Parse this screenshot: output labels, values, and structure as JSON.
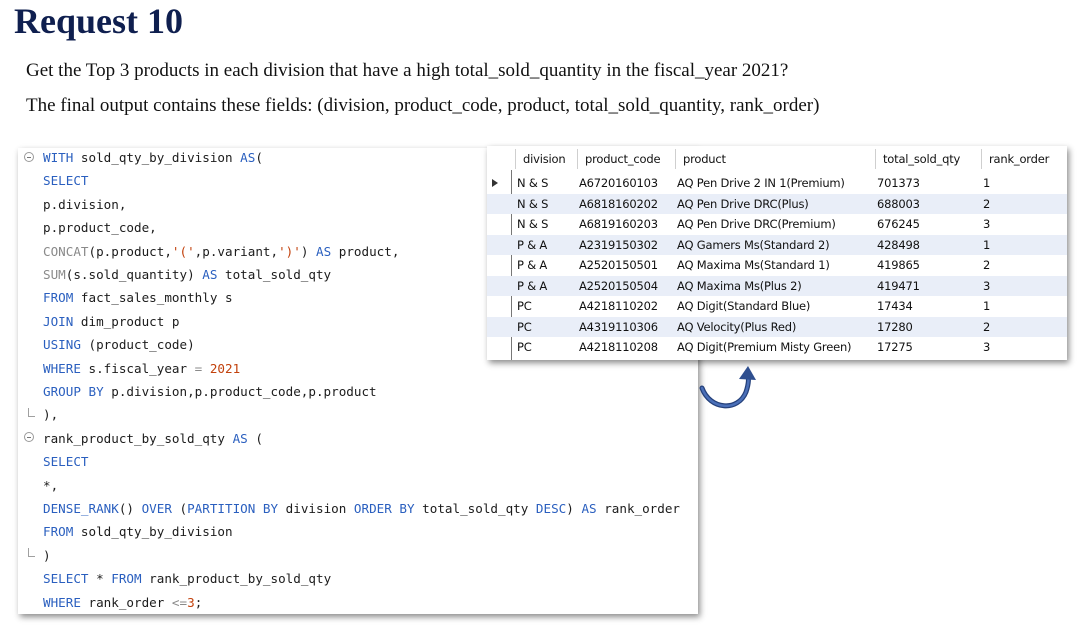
{
  "header": {
    "title": "Request 10",
    "description_line1": "Get the Top 3 products in each division that have a high total_sold_quantity in the fiscal_year 2021?",
    "description_line2": "The final output contains these fields: (division, product_code, product, total_sold_quantity, rank_order)"
  },
  "editor": {
    "lines": [
      [
        {
          "t": "WITH",
          "c": "kw"
        },
        {
          "t": " sold_qty_by_division ",
          "c": ""
        },
        {
          "t": "AS",
          "c": "kw"
        },
        {
          "t": "(",
          "c": ""
        }
      ],
      [
        {
          "t": "SELECT",
          "c": "kw"
        }
      ],
      [
        {
          "t": "p.division,",
          "c": ""
        }
      ],
      [
        {
          "t": "p.product_code,",
          "c": ""
        }
      ],
      [
        {
          "t": "CONCAT",
          "c": "fn"
        },
        {
          "t": "(p.product,",
          "c": ""
        },
        {
          "t": "'('",
          "c": "str"
        },
        {
          "t": ",p.variant,",
          "c": ""
        },
        {
          "t": "')'",
          "c": "str"
        },
        {
          "t": ") ",
          "c": ""
        },
        {
          "t": "AS",
          "c": "kw"
        },
        {
          "t": " product,",
          "c": ""
        }
      ],
      [
        {
          "t": "SUM",
          "c": "fn"
        },
        {
          "t": "(s.sold_quantity) ",
          "c": ""
        },
        {
          "t": "AS",
          "c": "kw"
        },
        {
          "t": " total_sold_qty",
          "c": ""
        }
      ],
      [
        {
          "t": "FROM",
          "c": "kw"
        },
        {
          "t": " fact_sales_monthly s",
          "c": ""
        }
      ],
      [
        {
          "t": "JOIN",
          "c": "kw"
        },
        {
          "t": " dim_product p",
          "c": ""
        }
      ],
      [
        {
          "t": "USING",
          "c": "kw"
        },
        {
          "t": " (product_code)",
          "c": ""
        }
      ],
      [
        {
          "t": "WHERE",
          "c": "kw"
        },
        {
          "t": " s.fiscal_year ",
          "c": ""
        },
        {
          "t": "=",
          "c": "fn"
        },
        {
          "t": " 2021",
          "c": "num"
        }
      ],
      [
        {
          "t": "GROUP BY",
          "c": "kw"
        },
        {
          "t": " p.division,p.product_code,p.product",
          "c": ""
        }
      ],
      [
        {
          "t": "),",
          "c": ""
        }
      ],
      [
        {
          "t": "rank_product_by_sold_qty ",
          "c": ""
        },
        {
          "t": "AS",
          "c": "kw"
        },
        {
          "t": " (",
          "c": ""
        }
      ],
      [
        {
          "t": "SELECT",
          "c": "kw"
        }
      ],
      [
        {
          "t": "*,",
          "c": ""
        }
      ],
      [
        {
          "t": "DENSE_RANK",
          "c": "kw"
        },
        {
          "t": "() ",
          "c": ""
        },
        {
          "t": "OVER",
          "c": "kw"
        },
        {
          "t": " (",
          "c": ""
        },
        {
          "t": "PARTITION BY",
          "c": "kw"
        },
        {
          "t": " division ",
          "c": ""
        },
        {
          "t": "ORDER BY",
          "c": "kw"
        },
        {
          "t": " total_sold_qty ",
          "c": ""
        },
        {
          "t": "DESC",
          "c": "kw"
        },
        {
          "t": ") ",
          "c": ""
        },
        {
          "t": "AS",
          "c": "kw"
        },
        {
          "t": " rank_order",
          "c": ""
        }
      ],
      [
        {
          "t": "FROM",
          "c": "kw"
        },
        {
          "t": " sold_qty_by_division",
          "c": ""
        }
      ],
      [
        {
          "t": ")",
          "c": ""
        }
      ],
      [
        {
          "t": "SELECT",
          "c": "kw"
        },
        {
          "t": " * ",
          "c": ""
        },
        {
          "t": "FROM",
          "c": "kw"
        },
        {
          "t": " rank_product_by_sold_qty",
          "c": ""
        }
      ],
      [
        {
          "t": "WHERE",
          "c": "kw"
        },
        {
          "t": " rank_order ",
          "c": ""
        },
        {
          "t": "<=",
          "c": "fn"
        },
        {
          "t": "3",
          "c": "num"
        },
        {
          "t": ";",
          "c": ""
        }
      ]
    ]
  },
  "result_grid": {
    "columns": [
      "division",
      "product_code",
      "product",
      "total_sold_qty",
      "rank_order"
    ],
    "rows": [
      [
        "N & S",
        "A6720160103",
        "AQ Pen Drive 2 IN 1(Premium)",
        "701373",
        "1"
      ],
      [
        "N & S",
        "A6818160202",
        "AQ Pen Drive DRC(Plus)",
        "688003",
        "2"
      ],
      [
        "N & S",
        "A6819160203",
        "AQ Pen Drive DRC(Premium)",
        "676245",
        "3"
      ],
      [
        "P & A",
        "A2319150302",
        "AQ Gamers Ms(Standard 2)",
        "428498",
        "1"
      ],
      [
        "P & A",
        "A2520150501",
        "AQ Maxima Ms(Standard 1)",
        "419865",
        "2"
      ],
      [
        "P & A",
        "A2520150504",
        "AQ Maxima Ms(Plus 2)",
        "419471",
        "3"
      ],
      [
        "PC",
        "A4218110202",
        "AQ Digit(Standard Blue)",
        "17434",
        "1"
      ],
      [
        "PC",
        "A4319110306",
        "AQ Velocity(Plus Red)",
        "17280",
        "2"
      ],
      [
        "PC",
        "A4218110208",
        "AQ Digit(Premium Misty Green)",
        "17275",
        "3"
      ]
    ]
  },
  "colors": {
    "title": "#0f1f4f",
    "keyword": "#2a5fbf",
    "string": "#c2410c",
    "row_alt": "#e9eef8",
    "arrow": "#2f4f8f"
  },
  "icons": [
    "fold-toggle-icon",
    "current-row-indicator-icon",
    "curved-arrow-icon"
  ]
}
